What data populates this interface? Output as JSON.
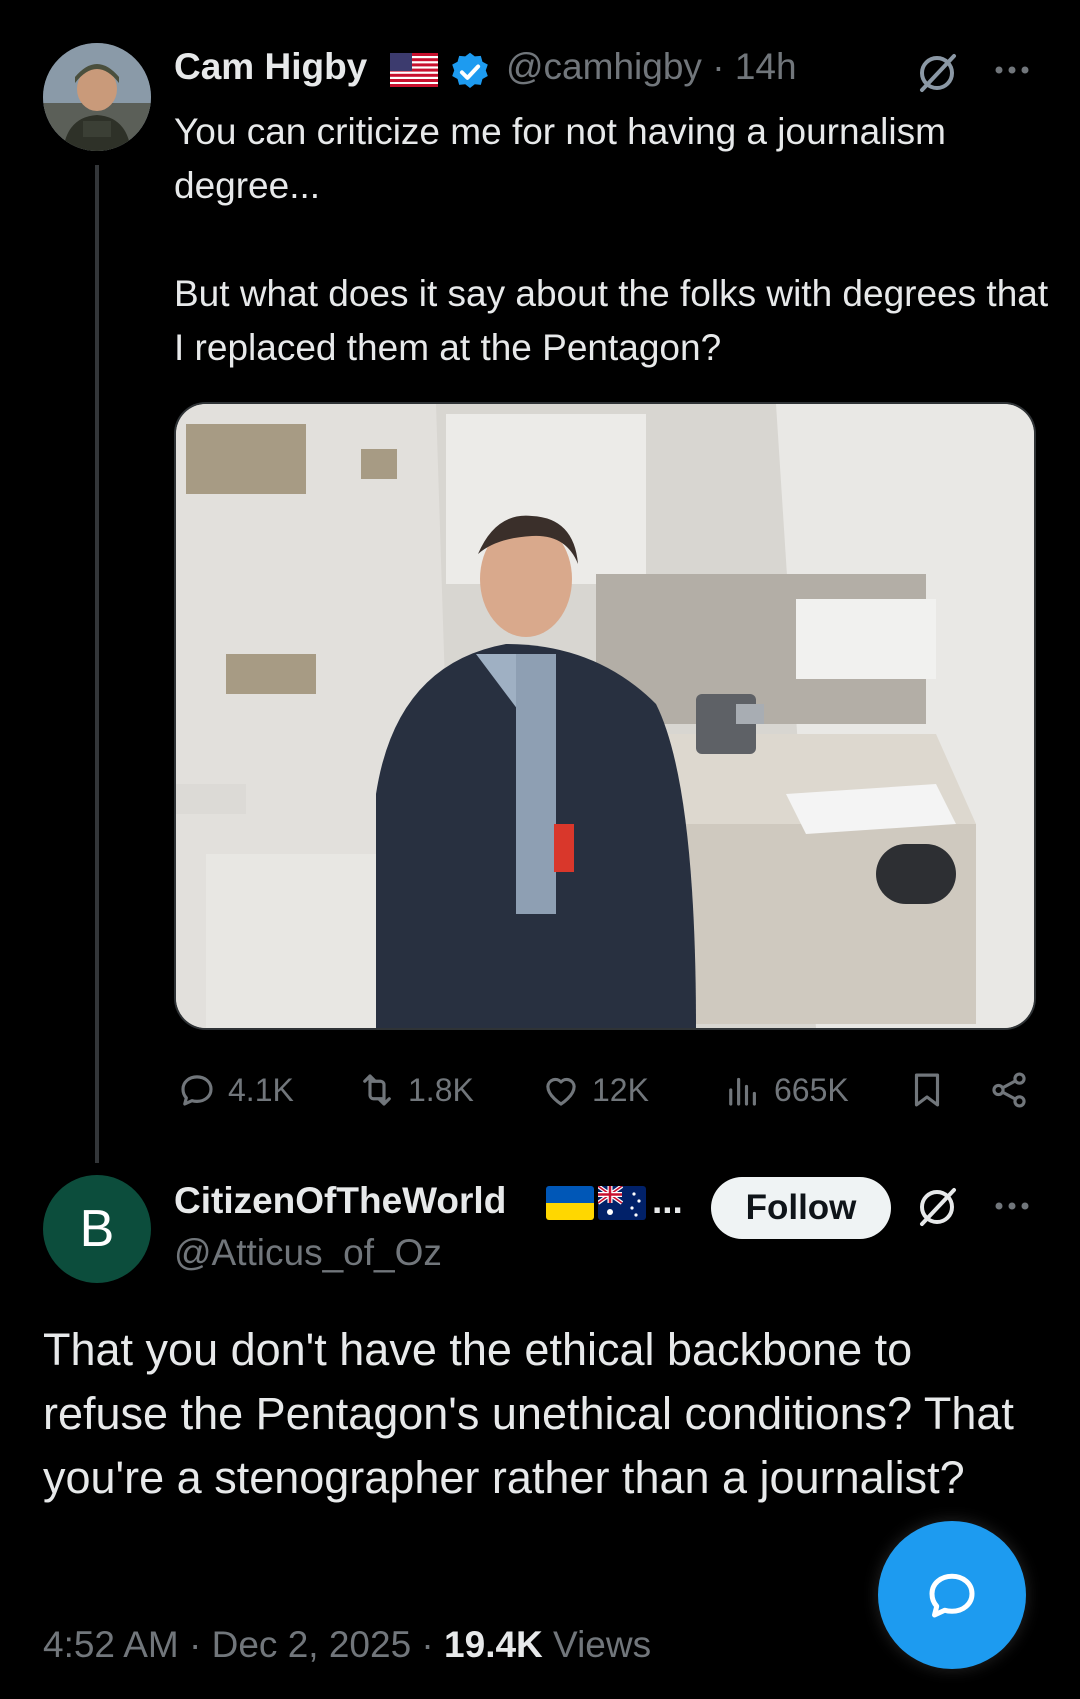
{
  "parent_tweet": {
    "author_name": "Cam Higby",
    "handle": "@camhigby",
    "separator": "·",
    "time_ago": "14h",
    "text": "You can criticize me for not having a journalism degree...\n\nBut what does it say about the folks with degrees that I replaced them at the Pentagon?",
    "stats": {
      "replies": "4.1K",
      "reposts": "1.8K",
      "likes": "12K",
      "views": "665K"
    },
    "icons": [
      "us-flag-icon",
      "verified-badge-icon",
      "grok-icon",
      "more-icon",
      "reply-icon",
      "repost-icon",
      "like-icon",
      "views-icon",
      "bookmark-icon",
      "share-icon"
    ]
  },
  "reply_tweet": {
    "avatar_letter": "B",
    "author_name": "CitizenOfTheWorld",
    "name_ellipsis": "...",
    "handle": "@Atticus_of_Oz",
    "follow_label": "Follow",
    "text": "That you don't have the ethical backbone to refuse the Pentagon's unethical conditions? That you're a stenographer rather than a journalist?",
    "timestamp": "4:52 AM · Dec 2, 2025 · ",
    "views_count": "19.4K",
    "views_label": " Views",
    "icons": [
      "ukraine-flag-icon",
      "australia-flag-icon",
      "grok-icon",
      "more-icon"
    ]
  },
  "colors": {
    "background": "#000000",
    "text": "#e7e9ea",
    "muted": "#71767b",
    "accent": "#1d9bf0",
    "reply_avatar": "#0c4d3c"
  }
}
